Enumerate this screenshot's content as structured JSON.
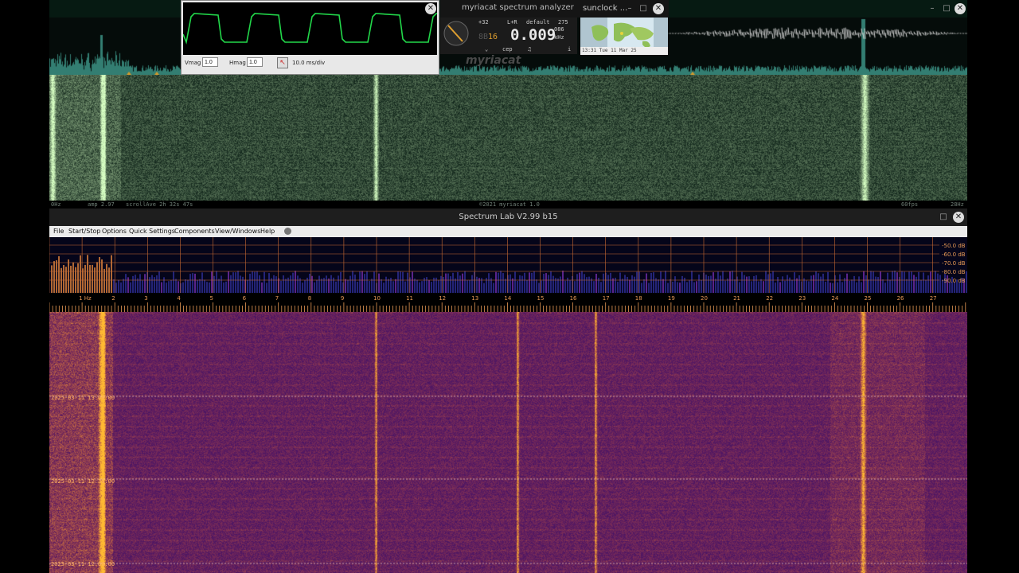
{
  "myriacat": {
    "title": "myriacat spectrum analyzer",
    "status": {
      "left_freq": "0Hz",
      "amp": "amp 2.97",
      "scroll": "scrollAve 2h 32s 47s",
      "copyright": "©2021 myriacat 1.0",
      "fps": "60fps",
      "right_freq": "28Hz"
    },
    "controls": {
      "gain": "+32",
      "channel": "L+R",
      "preset": "default",
      "number": "275",
      "digit1": "8B",
      "digit2": "16",
      "frequency": "0.009",
      "freq_small": "086",
      "unit": "kHz",
      "btn_a": "⌄",
      "btn_b": "cep",
      "btn_c": "♫",
      "btn_d": "i",
      "logo": "myriacat"
    },
    "scope": {
      "vmag_label": "Vmag",
      "vmag_value": "1.0",
      "hmag_label": "Hmag",
      "hmag_value": "1.0",
      "timebase": "10.0 ms/div"
    },
    "colors": {
      "wf_green": "#2fd67a",
      "wf_bg": "#03160e"
    }
  },
  "sunclock": {
    "title": "sunclock ...",
    "status": "13:31 Tue 11 Mar 25"
  },
  "spectrumlab": {
    "title": "Spectrum Lab V2.99 b15",
    "menu": [
      {
        "label": "File",
        "key": "F"
      },
      {
        "label": "Start/Stop",
        "key": "S"
      },
      {
        "label": "Options",
        "key": "O"
      },
      {
        "label": "Quick Settings",
        "key": "Q"
      },
      {
        "label": "Components",
        "key": "C"
      },
      {
        "label": "View/Windows",
        "key": "V"
      },
      {
        "label": "Help",
        "key": "H"
      }
    ],
    "db_labels": [
      "-50.0 dB",
      "-60.0 dB",
      "-70.0 dB",
      "-80.0 dB",
      "-90.0 dB"
    ],
    "freq_labels": [
      "1 Hz",
      "2",
      "3",
      "4",
      "5",
      "6",
      "7",
      "8",
      "9",
      "10",
      "11",
      "12",
      "13",
      "14",
      "15",
      "16",
      "17",
      "18",
      "19",
      "20",
      "21",
      "22",
      "23",
      "24",
      "25",
      "26",
      "27"
    ],
    "timestamps": [
      "2025-03-11 13:00:00",
      "2025-03-11 12:30:00",
      "2025-03-11 12:00:00"
    ],
    "colors": {
      "wf_bg": "#2a0f6a",
      "hot": "#ffb04a",
      "grid": "#c86a32"
    }
  }
}
